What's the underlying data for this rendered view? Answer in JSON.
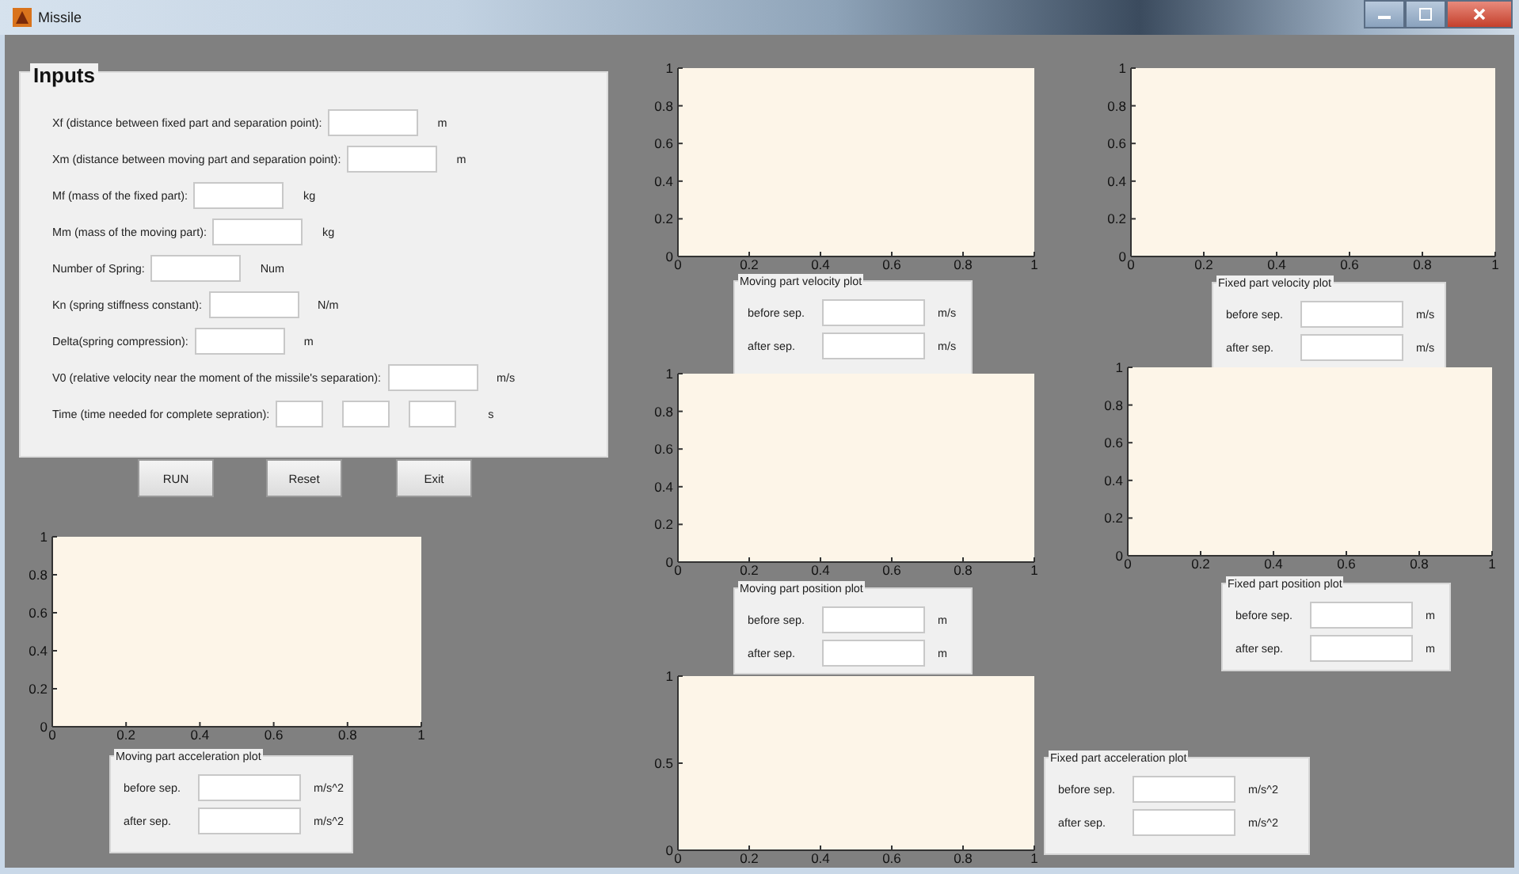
{
  "window": {
    "title": "Missile"
  },
  "inputs": {
    "title": "Inputs",
    "rows": [
      {
        "kind": "single",
        "label": "Xf (distance between fixed part and separation point):",
        "unit": "m"
      },
      {
        "kind": "single",
        "label": "Xm (distance between moving part and separation point):",
        "unit": "m"
      },
      {
        "kind": "single",
        "label": "Mf (mass of the fixed part):",
        "unit": "kg"
      },
      {
        "kind": "single",
        "label": "Mm (mass of the moving part):",
        "unit": "kg"
      },
      {
        "kind": "single",
        "label": "Number of Spring:",
        "unit": "Num"
      },
      {
        "kind": "single",
        "label": "Kn (spring stiffness constant):",
        "unit": "N/m"
      },
      {
        "kind": "single",
        "label": "Delta(spring compression):",
        "unit": "m"
      },
      {
        "kind": "single",
        "label": "V0 (relative velocity near the moment of the missile's separation):",
        "unit": "m/s"
      },
      {
        "kind": "time",
        "label": "Time (time needed for complete sepration):",
        "unit": "s"
      }
    ]
  },
  "buttons": [
    "RUN",
    "Reset",
    "Exit"
  ],
  "plots": [
    {
      "chart_data": {
        "type": "line",
        "xlim": [
          0,
          1
        ],
        "ylim": [
          0,
          1
        ],
        "xticks": [
          0,
          0.2,
          0.4,
          0.6,
          0.8,
          1
        ],
        "yticks": [
          0,
          0.2,
          0.4,
          0.6,
          0.8,
          1
        ]
      },
      "results": {
        "title": "Moving part velocity plot",
        "rows": [
          {
            "label": "before sep.",
            "unit": "m/s"
          },
          {
            "label": "after sep.",
            "unit": "m/s"
          }
        ]
      }
    },
    {
      "chart_data": {
        "type": "line",
        "xlim": [
          0,
          1
        ],
        "ylim": [
          0,
          1
        ],
        "xticks": [
          0,
          0.2,
          0.4,
          0.6,
          0.8,
          1
        ],
        "yticks": [
          0,
          0.2,
          0.4,
          0.6,
          0.8,
          1
        ]
      },
      "results": {
        "title": "Fixed part velocity plot",
        "rows": [
          {
            "label": "before sep.",
            "unit": "m/s"
          },
          {
            "label": "after sep.",
            "unit": "m/s"
          }
        ]
      }
    },
    {
      "chart_data": {
        "type": "line",
        "xlim": [
          0,
          1
        ],
        "ylim": [
          0,
          1
        ],
        "xticks": [
          0,
          0.2,
          0.4,
          0.6,
          0.8,
          1
        ],
        "yticks": [
          0,
          0.2,
          0.4,
          0.6,
          0.8,
          1
        ]
      },
      "results": {
        "title": "Moving part position plot",
        "rows": [
          {
            "label": "before sep.",
            "unit": "m"
          },
          {
            "label": "after sep.",
            "unit": "m"
          }
        ]
      }
    },
    {
      "chart_data": {
        "type": "line",
        "xlim": [
          0,
          1
        ],
        "ylim": [
          0,
          1
        ],
        "xticks": [
          0,
          0.2,
          0.4,
          0.6,
          0.8,
          1
        ],
        "yticks": [
          0,
          0.2,
          0.4,
          0.6,
          0.8,
          1
        ]
      },
      "results": {
        "title": "Fixed part position plot",
        "rows": [
          {
            "label": "before sep.",
            "unit": "m"
          },
          {
            "label": "after sep.",
            "unit": "m"
          }
        ]
      }
    },
    {
      "chart_data": {
        "type": "line",
        "xlim": [
          0,
          1
        ],
        "ylim": [
          0,
          1
        ],
        "xticks": [
          0,
          0.2,
          0.4,
          0.6,
          0.8,
          1
        ],
        "yticks": [
          0,
          0.2,
          0.4,
          0.6,
          0.8,
          1
        ]
      },
      "results": {
        "title": "Moving part acceleration plot",
        "rows": [
          {
            "label": "before sep.",
            "unit": "m/s^2"
          },
          {
            "label": "after sep.",
            "unit": "m/s^2"
          }
        ]
      }
    },
    {
      "chart_data": {
        "type": "line",
        "xlim": [
          0,
          1
        ],
        "ylim": [
          0,
          1
        ],
        "xticks": [
          0,
          0.2,
          0.4,
          0.6,
          0.8,
          1
        ],
        "yticks": [
          0,
          0.5,
          1
        ]
      },
      "results": {
        "title": "Fixed part acceleration plot",
        "rows": [
          {
            "label": "before sep.",
            "unit": "m/s^2"
          },
          {
            "label": "after sep.",
            "unit": "m/s^2"
          }
        ]
      }
    }
  ]
}
